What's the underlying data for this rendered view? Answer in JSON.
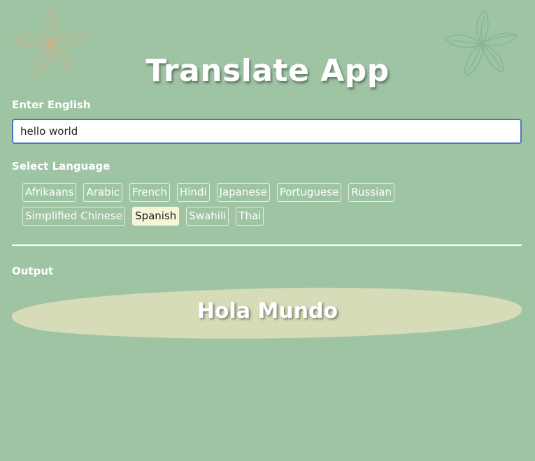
{
  "app": {
    "title": "Translate App"
  },
  "input": {
    "label": "Enter English",
    "value": "hello world"
  },
  "languages": {
    "label": "Select Language",
    "selected": "Spanish",
    "rows": [
      [
        "Afrikaans",
        "Arabic",
        "French",
        "Hindi",
        "Japanese",
        "Portuguese",
        "Russian"
      ],
      [
        "Simplified Chinese",
        "Spanish",
        "Swahili",
        "Thai"
      ]
    ]
  },
  "output": {
    "label": "Output",
    "text": "Hola Mundo"
  },
  "icons": {
    "flower_left": "flower-outline-icon",
    "flower_right": "flower-outline-icon"
  },
  "colors": {
    "background": "#9ec4a4",
    "flower_left": "#c9b48a",
    "flower_right": "#84b894",
    "selected_button": "#f5f6d8",
    "output_blob": "#d6dcb8",
    "input_border": "#4a78c2"
  }
}
